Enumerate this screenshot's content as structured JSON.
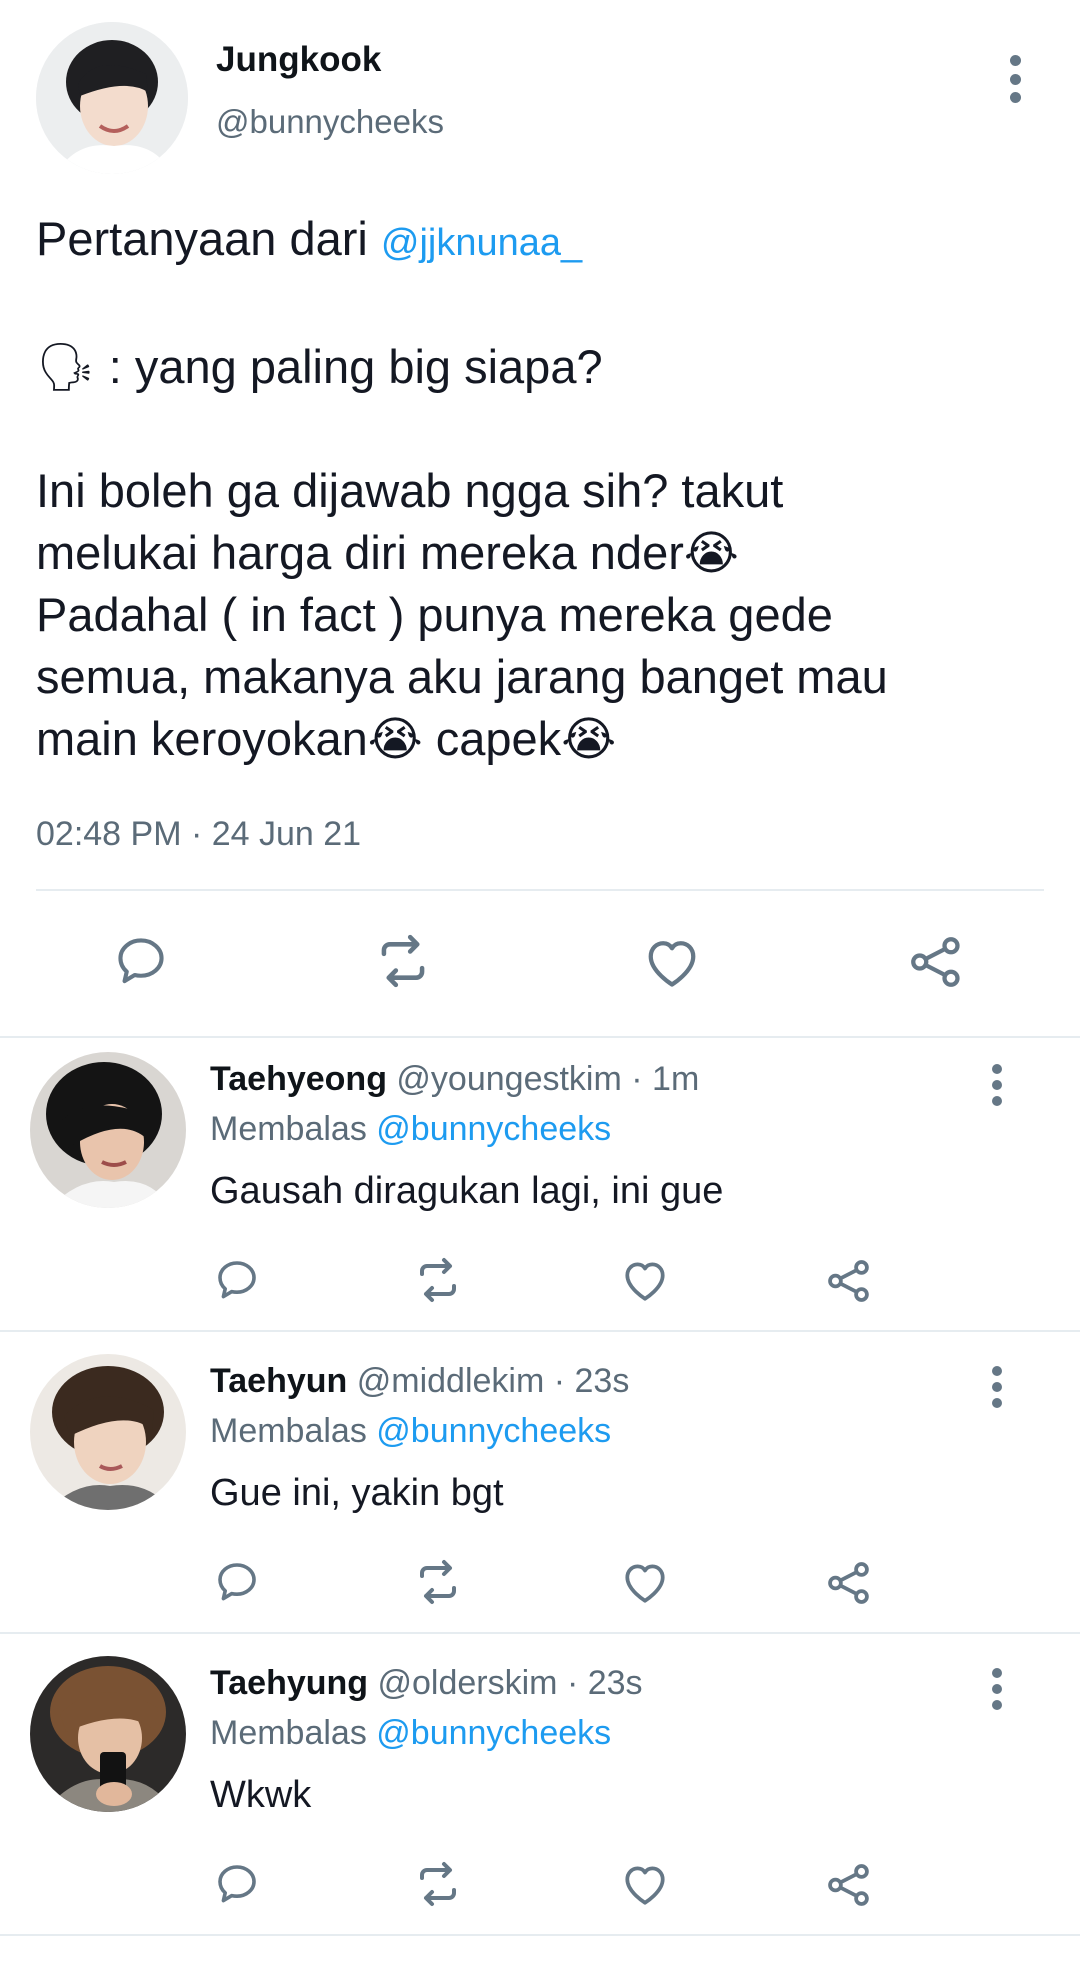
{
  "main_tweet": {
    "display_name": "Jungkook",
    "handle": "@bunnycheeks",
    "text_prefix": "Pertanyaan dari ",
    "mention": "@jjknunaa_",
    "speaking_emoji": "🗣",
    "question": " : yang paling big siapa?",
    "body_line1": "Ini boleh ga dijawab ngga sih? takut",
    "body_line2": "melukai harga diri mereka nder",
    "crying_emoji": "😭",
    "body_line3": "Padahal ( in fact ) punya mereka gede",
    "body_line4": "semua, makanya aku jarang banget mau",
    "body_line5_a": "main keroyokan",
    "body_line5_b": " capek",
    "timestamp": "02:48 PM · 24 Jun 21"
  },
  "replies": [
    {
      "display_name": "Taehyeong",
      "handle": "@youngestkim",
      "time": "· 1m",
      "replying_label": "Membalas ",
      "replying_to": "@bunnycheeks",
      "text": "Gausah diragukan lagi, ini gue"
    },
    {
      "display_name": "Taehyun",
      "handle": "@middlekim",
      "time": "· 23s",
      "replying_label": "Membalas ",
      "replying_to": "@bunnycheeks",
      "text": "Gue ini, yakin bgt"
    },
    {
      "display_name": "Taehyung",
      "handle": "@olderskim",
      "time": "· 23s",
      "replying_label": "Membalas ",
      "replying_to": "@bunnycheeks",
      "text": "Wkwk"
    }
  ],
  "icons": [
    "reply-icon",
    "retweet-icon",
    "like-icon",
    "share-icon",
    "more-options-icon"
  ],
  "colors": {
    "accent": "#1d9bf0",
    "icon_gray": "#657786",
    "divider": "#e6ecf0"
  }
}
